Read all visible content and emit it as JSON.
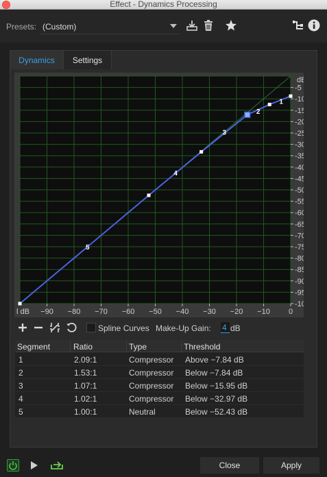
{
  "window": {
    "title": "Effect - Dynamics Processing"
  },
  "presets": {
    "label": "Presets:",
    "value": "(Custom)",
    "icons": [
      "save-preset-icon",
      "delete-preset-icon",
      "favorite-star-icon",
      "routing-icon",
      "info-icon"
    ]
  },
  "tabs": [
    {
      "label": "Dynamics",
      "active": true
    },
    {
      "label": "Settings",
      "active": false
    }
  ],
  "graph": {
    "y_unit": "dB",
    "y_top_label": "dB O",
    "y_ticks": [
      "-5",
      "-10",
      "-15",
      "-20",
      "-25",
      "-30",
      "-35",
      "-40",
      "-45",
      "-50",
      "-55",
      "-60",
      "-65",
      "-70",
      "-75",
      "-80",
      "-85",
      "-90",
      "-95",
      "-100"
    ],
    "x_ticks": [
      "−90",
      "−80",
      "−70",
      "−60",
      "−50",
      "−40",
      "−30",
      "−20",
      "−10",
      "0"
    ],
    "x_first_label": "l dB",
    "points": [
      {
        "x": -100,
        "y": -100
      },
      {
        "x": -52.4,
        "y": -52.4
      },
      {
        "x": -33,
        "y": -33.3
      },
      {
        "x": -16,
        "y": -17.0
      },
      {
        "x": -7.8,
        "y": -12.5
      },
      {
        "x": 0,
        "y": -8.8
      }
    ],
    "segment_labels": [
      {
        "label": "1",
        "x": -3.5,
        "y": -11.0
      },
      {
        "label": "2",
        "x": -12.0,
        "y": -15.3
      },
      {
        "label": "3",
        "x": -24.5,
        "y": -24.5
      },
      {
        "label": "4",
        "x": -42.5,
        "y": -42.5
      },
      {
        "label": "5",
        "x": -75.0,
        "y": -75.0
      }
    ],
    "line_color": "#4a63e0",
    "grid_color": "#1f5a1f",
    "background": "#0e0e0e"
  },
  "tools": {
    "add_icon": "plus-icon",
    "remove_icon": "minus-icon",
    "reset_icon": "reset-graph-icon",
    "invert_icon": "invert-icon",
    "spline_label": "Spline Curves",
    "makeup_label": "Make-Up Gain:",
    "makeup_value": "4",
    "makeup_unit": "dB"
  },
  "table": {
    "headers": [
      "Segment",
      "Ratio",
      "Type",
      "Threshold"
    ],
    "rows": [
      [
        "1",
        "2.09:1",
        "Compressor",
        "Above −7.84 dB"
      ],
      [
        "2",
        "1.53:1",
        "Compressor",
        "Below −7.84 dB"
      ],
      [
        "3",
        "1.07:1",
        "Compressor",
        "Below −15.95 dB"
      ],
      [
        "4",
        "1.02:1",
        "Compressor",
        "Below −32.97 dB"
      ],
      [
        "5",
        "1.00:1",
        "Neutral",
        "Below −52.43 dB"
      ]
    ]
  },
  "footer": {
    "close_label": "Close",
    "apply_label": "Apply",
    "power_color": "#3a9e3a"
  }
}
